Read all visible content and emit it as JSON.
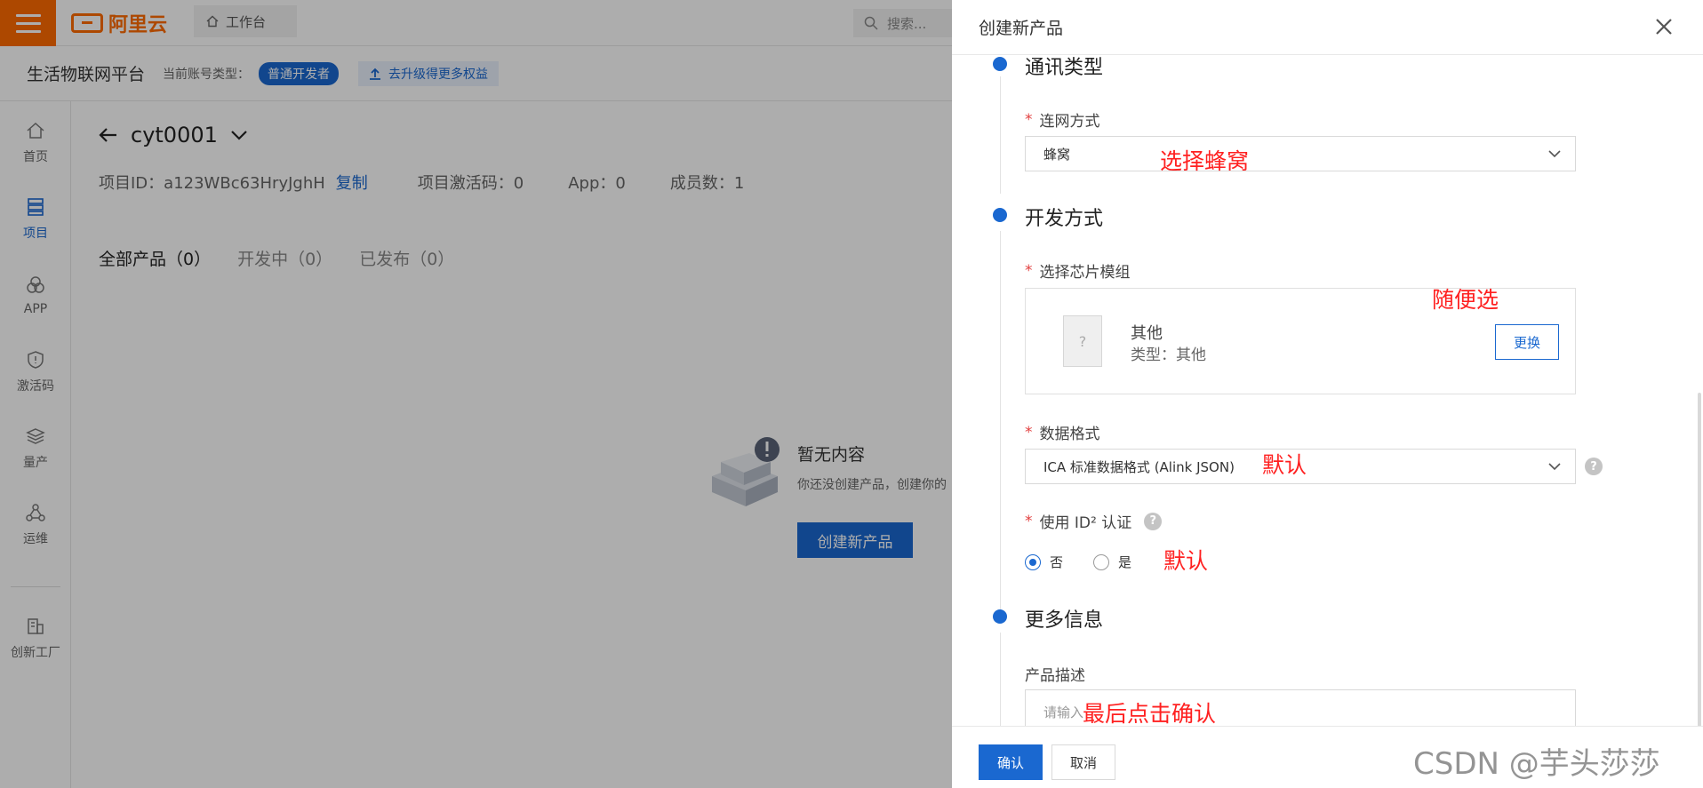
{
  "topbar": {
    "logo_text": "阿里云",
    "workbench_label": "工作台",
    "search_placeholder": "搜索..."
  },
  "subheader": {
    "platform_title": "生活物联网平台",
    "account_type_label": "当前账号类型：",
    "account_type_badge": "普通开发者",
    "upgrade_label": "去升级得更多权益"
  },
  "leftnav": {
    "items": [
      {
        "label": "首页",
        "icon": "home-icon"
      },
      {
        "label": "项目",
        "icon": "project-icon"
      },
      {
        "label": "APP",
        "icon": "app-icon"
      },
      {
        "label": "激活码",
        "icon": "shield-icon"
      },
      {
        "label": "量产",
        "icon": "layers-icon"
      },
      {
        "label": "运维",
        "icon": "ops-icon"
      },
      {
        "label": "创新工厂",
        "icon": "factory-icon"
      }
    ],
    "active_index": 1
  },
  "project": {
    "name": "cyt0001",
    "id_text": "项目ID：a123WBc63HryJghH",
    "copy_label": "复制",
    "activation_codes": "项目激活码：0",
    "app_count": "App：0",
    "member_count": "成员数：1"
  },
  "tabs": [
    {
      "label": "全部产品（0）"
    },
    {
      "label": "开发中（0）"
    },
    {
      "label": "已发布（0）"
    }
  ],
  "empty_state": {
    "title": "暂无内容",
    "description": "你还没创建产品，创建你的",
    "button_label": "创建新产品"
  },
  "drawer": {
    "title": "创建新产品",
    "sections": {
      "comm_title": "通讯类型",
      "dev_title": "开发方式",
      "more_title": "更多信息"
    },
    "network": {
      "label": "连网方式",
      "value": "蜂窝"
    },
    "chip": {
      "label": "选择芯片模组",
      "name": "其他",
      "type": "类型：其他",
      "change_label": "更换"
    },
    "data_format": {
      "label": "数据格式",
      "value": "ICA 标准数据格式 (Alink JSON)"
    },
    "id2": {
      "label": "使用 ID² 认证",
      "option_no": "否",
      "option_yes": "是",
      "selected": "否"
    },
    "description": {
      "label": "产品描述",
      "placeholder": "请输入"
    },
    "footer": {
      "ok_label": "确认",
      "cancel_label": "取消"
    }
  },
  "annotations": {
    "network": "选择蜂窝",
    "chip": "随便选",
    "data_format": "默认",
    "id2": "默认",
    "final": "最后点击确认"
  },
  "watermark": "CSDN @芋头莎莎",
  "colors": {
    "brand_orange": "#ff6a00",
    "primary_blue": "#1a68d0",
    "annotation_red": "#ff2020"
  }
}
